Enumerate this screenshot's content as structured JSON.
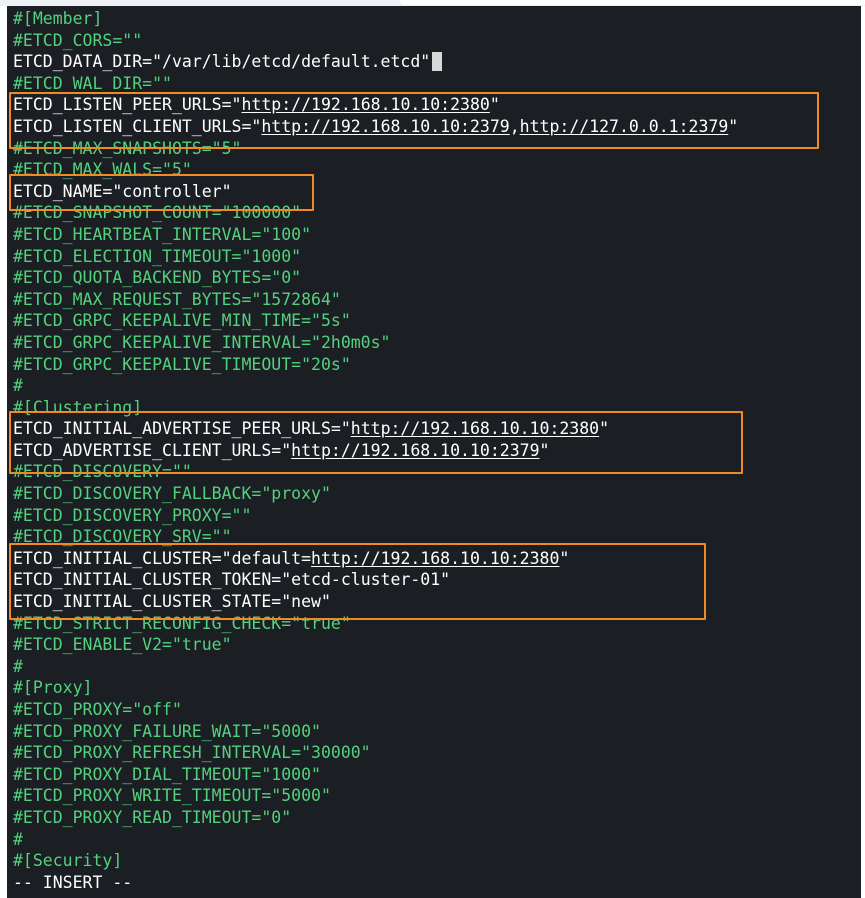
{
  "editor": {
    "lines": [
      {
        "type": "comment",
        "text": "#[Member]"
      },
      {
        "type": "comment",
        "text": "#ETCD_CORS=\"\""
      },
      {
        "type": "setting",
        "key": "ETCD_DATA_DIR",
        "value": "/var/lib/etcd/default.etcd"
      },
      {
        "type": "comment",
        "text": "#ETCD_WAL_DIR=\"\""
      },
      {
        "type": "setting",
        "key": "ETCD_LISTEN_PEER_URLS",
        "urls": [
          "http://192.168.10.10:2380"
        ]
      },
      {
        "type": "setting",
        "key": "ETCD_LISTEN_CLIENT_URLS",
        "urls": [
          "http://192.168.10.10:2379",
          "http://127.0.0.1:2379"
        ]
      },
      {
        "type": "comment",
        "text": "#ETCD_MAX_SNAPSHOTS=\"5\""
      },
      {
        "type": "comment",
        "text": "#ETCD_MAX_WALS=\"5\""
      },
      {
        "type": "setting",
        "key": "ETCD_NAME",
        "value": "controller"
      },
      {
        "type": "comment",
        "text": "#ETCD_SNAPSHOT_COUNT=\"100000\""
      },
      {
        "type": "comment",
        "text": "#ETCD_HEARTBEAT_INTERVAL=\"100\""
      },
      {
        "type": "comment",
        "text": "#ETCD_ELECTION_TIMEOUT=\"1000\""
      },
      {
        "type": "comment",
        "text": "#ETCD_QUOTA_BACKEND_BYTES=\"0\""
      },
      {
        "type": "comment",
        "text": "#ETCD_MAX_REQUEST_BYTES=\"1572864\""
      },
      {
        "type": "comment",
        "text": "#ETCD_GRPC_KEEPALIVE_MIN_TIME=\"5s\""
      },
      {
        "type": "comment",
        "text": "#ETCD_GRPC_KEEPALIVE_INTERVAL=\"2h0m0s\""
      },
      {
        "type": "comment",
        "text": "#ETCD_GRPC_KEEPALIVE_TIMEOUT=\"20s\""
      },
      {
        "type": "comment",
        "text": "#"
      },
      {
        "type": "comment",
        "text": "#[Clustering]"
      },
      {
        "type": "setting",
        "key": "ETCD_INITIAL_ADVERTISE_PEER_URLS",
        "urls": [
          "http://192.168.10.10:2380"
        ]
      },
      {
        "type": "setting",
        "key": "ETCD_ADVERTISE_CLIENT_URLS",
        "urls": [
          "http://192.168.10.10:2379"
        ]
      },
      {
        "type": "comment",
        "text": "#ETCD_DISCOVERY=\"\""
      },
      {
        "type": "comment",
        "text": "#ETCD_DISCOVERY_FALLBACK=\"proxy\""
      },
      {
        "type": "comment",
        "text": "#ETCD_DISCOVERY_PROXY=\"\""
      },
      {
        "type": "comment",
        "text": "#ETCD_DISCOVERY_SRV=\"\""
      },
      {
        "type": "setting",
        "key": "ETCD_INITIAL_CLUSTER",
        "prefix": "default=",
        "urls": [
          "http://192.168.10.10:2380"
        ]
      },
      {
        "type": "setting",
        "key": "ETCD_INITIAL_CLUSTER_TOKEN",
        "value": "etcd-cluster-01"
      },
      {
        "type": "setting",
        "key": "ETCD_INITIAL_CLUSTER_STATE",
        "value": "new"
      },
      {
        "type": "comment",
        "text": "#ETCD_STRICT_RECONFIG_CHECK=\"true\""
      },
      {
        "type": "comment",
        "text": "#ETCD_ENABLE_V2=\"true\""
      },
      {
        "type": "comment",
        "text": "#"
      },
      {
        "type": "comment",
        "text": "#[Proxy]"
      },
      {
        "type": "comment",
        "text": "#ETCD_PROXY=\"off\""
      },
      {
        "type": "comment",
        "text": "#ETCD_PROXY_FAILURE_WAIT=\"5000\""
      },
      {
        "type": "comment",
        "text": "#ETCD_PROXY_REFRESH_INTERVAL=\"30000\""
      },
      {
        "type": "comment",
        "text": "#ETCD_PROXY_DIAL_TIMEOUT=\"1000\""
      },
      {
        "type": "comment",
        "text": "#ETCD_PROXY_WRITE_TIMEOUT=\"5000\""
      },
      {
        "type": "comment",
        "text": "#ETCD_PROXY_READ_TIMEOUT=\"0\""
      },
      {
        "type": "comment",
        "text": "#"
      },
      {
        "type": "comment",
        "text": "#[Security]"
      },
      {
        "type": "mode",
        "text": "-- INSERT --"
      }
    ]
  },
  "colors": {
    "background": "#1b1e22",
    "comment": "#52d17e",
    "text": "#ffffff",
    "highlight_box": "#f08a24"
  }
}
